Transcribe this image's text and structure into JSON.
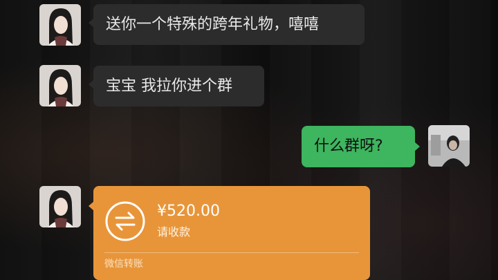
{
  "messages": [
    {
      "sender": "contact",
      "text": "送你一个特殊的跨年礼物，嘻嘻"
    },
    {
      "sender": "contact",
      "text": "宝宝 我拉你进个群"
    },
    {
      "sender": "me",
      "text": "什么群呀?"
    }
  ],
  "transfer": {
    "amount": "¥520.00",
    "status": "请收款",
    "footer": "微信转账",
    "icon": "transfer-arrows-icon"
  },
  "colors": {
    "incoming_bubble": "#2c2c2c",
    "outgoing_bubble": "#3eb55f",
    "transfer_card": "#e8953a",
    "background": "#111111"
  }
}
